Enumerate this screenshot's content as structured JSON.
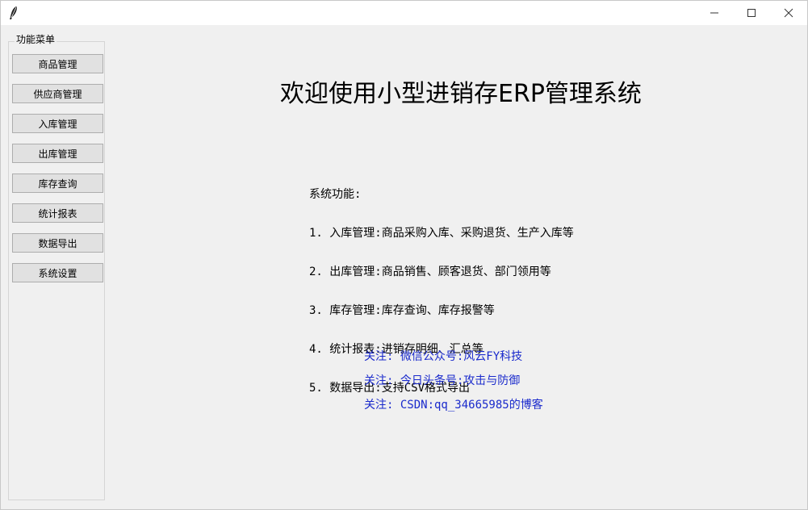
{
  "titlebar": {
    "icon": "feather-icon",
    "controls": [
      "minimize-icon",
      "maximize-icon",
      "close-icon"
    ]
  },
  "sidebar": {
    "title": "功能菜单",
    "items": [
      {
        "label": "商品管理"
      },
      {
        "label": "供应商管理"
      },
      {
        "label": "入库管理"
      },
      {
        "label": "出库管理"
      },
      {
        "label": "库存查询"
      },
      {
        "label": "统计报表"
      },
      {
        "label": "数据导出"
      },
      {
        "label": "系统设置"
      }
    ]
  },
  "main": {
    "title": "欢迎使用小型进销存ERP管理系统",
    "features": [
      "系统功能:",
      "1. 入库管理:商品采购入库、采购退货、生产入库等",
      "2. 出库管理:商品销售、顾客退货、部门领用等",
      "3. 库存管理:库存查询、库存报警等",
      "4. 统计报表:进销存明细、汇总等",
      "5. 数据导出:支持CSV格式导出"
    ],
    "follow": [
      "关注: 微信公众号:风云FY科技",
      "关注: 今日头条号:攻击与防御",
      "关注: CSDN:qq_34665985的博客"
    ],
    "follow_color": "#1a2acc"
  }
}
